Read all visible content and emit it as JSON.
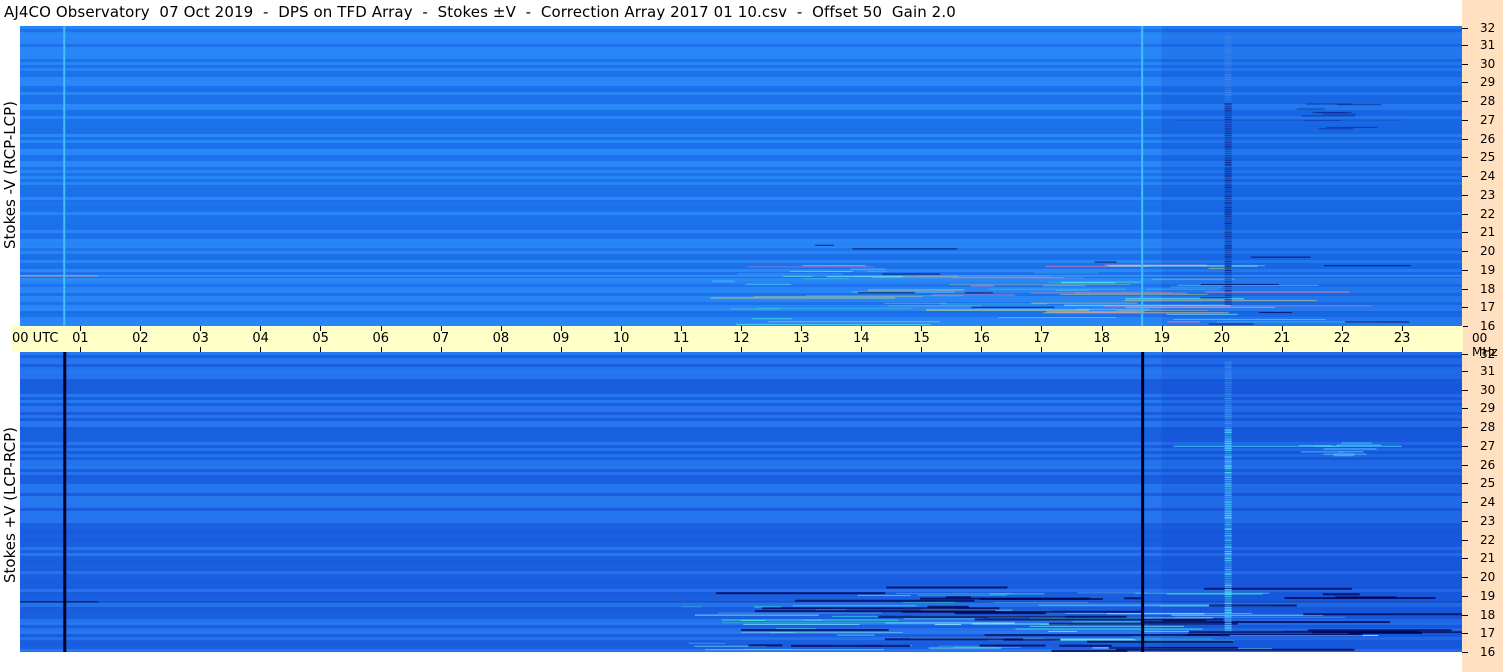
{
  "header": {
    "title": "AJ4CO Observatory  07 Oct 2019  -  DPS on TFD Array  -  Stokes ±V  -  Correction Array 2017 01 10.csv  -  Offset 50  Gain 2.0"
  },
  "panels": {
    "top_label": "Stokes -V (RCP-LCP)",
    "bottom_label": "Stokes +V (LCP-RCP)"
  },
  "time_axis": {
    "start_label": "00 UTC",
    "hour_labels": [
      "01",
      "02",
      "03",
      "04",
      "05",
      "06",
      "07",
      "08",
      "09",
      "10",
      "11",
      "12",
      "13",
      "14",
      "15",
      "16",
      "17",
      "18",
      "19",
      "20",
      "21",
      "22",
      "23"
    ],
    "end_label": "00 MHz"
  },
  "chart_data": {
    "type": "heatmap",
    "title": "AJ4CO Observatory  07 Oct 2019  -  DPS on TFD Array  -  Stokes ±V  -  Correction Array 2017 01 10.csv  -  Offset 50  Gain 2.0",
    "xlabel": "UTC",
    "ylabel": "MHz",
    "x_range_hours": [
      0,
      24
    ],
    "y_range_mhz": [
      16,
      32
    ],
    "y_ticks": [
      32,
      31,
      30,
      29,
      28,
      27,
      26,
      25,
      24,
      23,
      22,
      21,
      20,
      19,
      18,
      17,
      16
    ],
    "panels": [
      {
        "name": "Stokes -V (RCP-LCP)",
        "base_color": "#1e78f0"
      },
      {
        "name": "Stokes +V (LCP-RCP)",
        "base_color": "#1c64e6"
      }
    ],
    "colors": {
      "background_high": "#2a88f8",
      "background_low": "#1650d8",
      "emission": "#40e8c8",
      "hot": "#f0e060",
      "absorption": "#000050"
    }
  }
}
